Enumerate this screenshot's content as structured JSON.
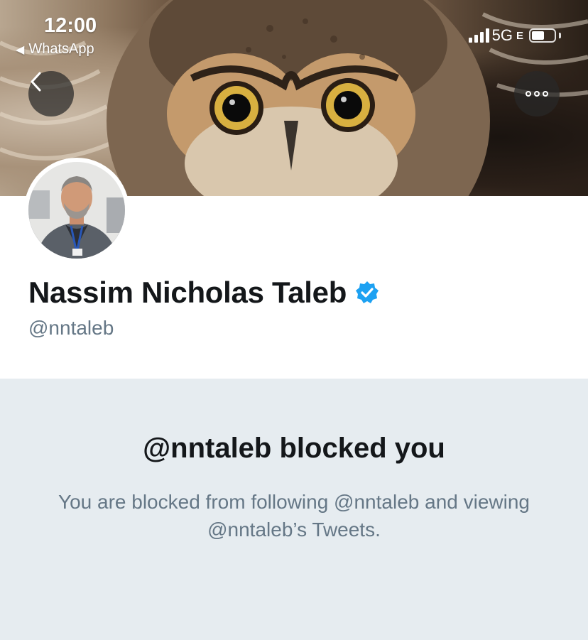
{
  "status_bar": {
    "time": "12:00",
    "back_app": "WhatsApp",
    "network": "5G",
    "network_suffix": "E"
  },
  "profile": {
    "name": "Nassim Nicholas Taleb",
    "handle": "@nntaleb",
    "verified": true
  },
  "blocked": {
    "title": "@nntaleb blocked you",
    "message": "You are blocked from following @nntaleb and viewing @nntaleb’s Tweets."
  },
  "colors": {
    "verified_blue": "#1da1f2",
    "panel_bg": "#e6ecf0",
    "secondary_text": "#657786"
  },
  "icons": {
    "back": "chevron-left-icon",
    "more": "more-icon",
    "verified": "verified-badge-icon"
  }
}
